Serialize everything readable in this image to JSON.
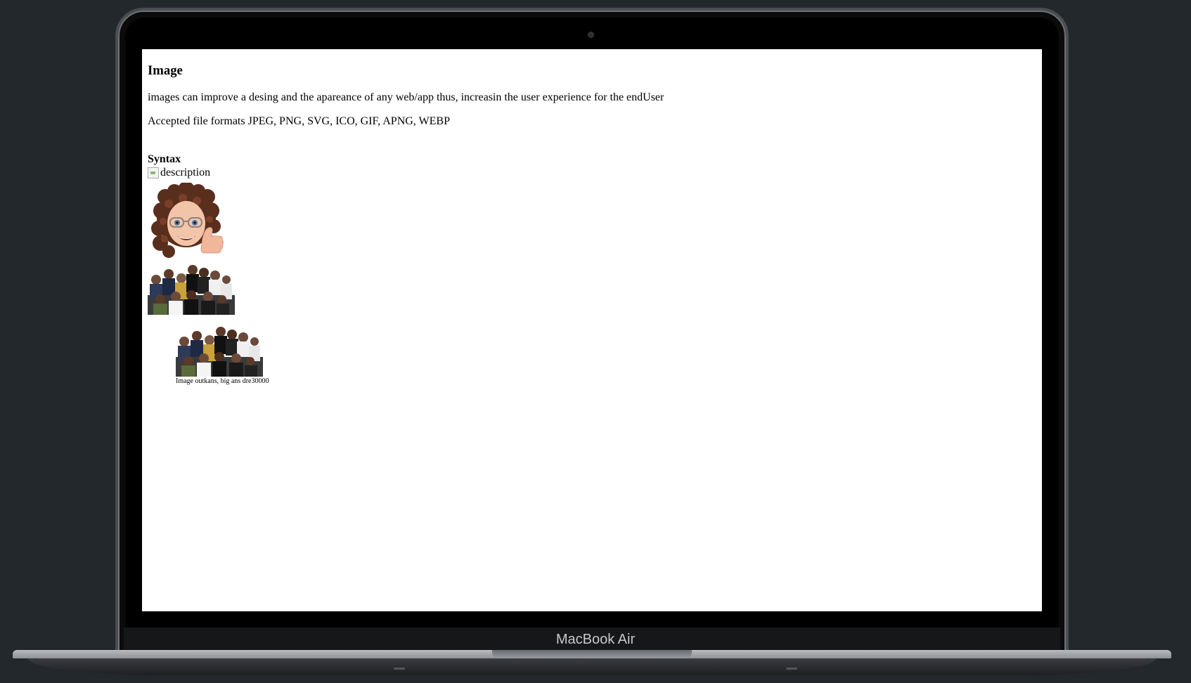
{
  "device": {
    "brand_label": "MacBook Air"
  },
  "page": {
    "heading": "Image",
    "intro": "images can improve a desing and the apareance of any web/app thus, increasin the user experience for the endUser",
    "formats": "Accepted file formats JPEG, PNG, SVG, ICO, GIF, APNG, WEBP",
    "syntax_title": "Syntax",
    "broken_image_alt": "description",
    "figure_caption": "Image outkans, big ans dre30000"
  },
  "images": {
    "avatar": "memoji-avatar-thumbs-up",
    "group": "group-photo"
  }
}
